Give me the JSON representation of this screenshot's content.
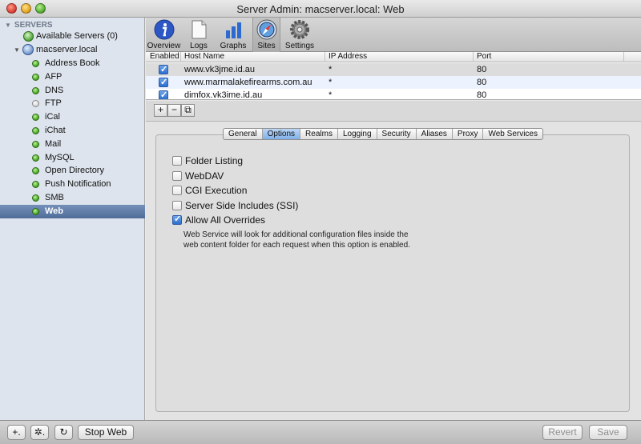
{
  "window": {
    "title": "Server Admin: macserver.local: Web"
  },
  "sidebar": {
    "section_label": "SERVERS",
    "available_servers": "Available Servers (0)",
    "server_name": "macserver.local",
    "services": [
      {
        "label": "Address Book",
        "status": "running"
      },
      {
        "label": "AFP",
        "status": "running"
      },
      {
        "label": "DNS",
        "status": "running"
      },
      {
        "label": "FTP",
        "status": "stopped"
      },
      {
        "label": "iCal",
        "status": "running"
      },
      {
        "label": "iChat",
        "status": "running"
      },
      {
        "label": "Mail",
        "status": "running"
      },
      {
        "label": "MySQL",
        "status": "running"
      },
      {
        "label": "Open Directory",
        "status": "running"
      },
      {
        "label": "Push Notification",
        "status": "running"
      },
      {
        "label": "SMB",
        "status": "running"
      },
      {
        "label": "Web",
        "status": "running",
        "selected": true
      }
    ]
  },
  "toolbar": {
    "items": [
      {
        "label": "Overview",
        "icon": "info-icon"
      },
      {
        "label": "Logs",
        "icon": "document-icon"
      },
      {
        "label": "Graphs",
        "icon": "bar-chart-icon"
      },
      {
        "label": "Sites",
        "icon": "compass-icon",
        "active": true
      },
      {
        "label": "Settings",
        "icon": "gear-icon"
      }
    ]
  },
  "sites_table": {
    "headers": {
      "enabled": "Enabled",
      "host": "Host Name",
      "ip": "IP Address",
      "port": "Port"
    },
    "rows": [
      {
        "enabled": true,
        "host": "www.vk3jme.id.au",
        "ip": "*",
        "port": "80"
      },
      {
        "enabled": true,
        "host": "www.marmalakefirearms.com.au",
        "ip": "*",
        "port": "80"
      },
      {
        "enabled": true,
        "host": "dimfox.vk3ime.id.au",
        "ip": "*",
        "port": "80"
      }
    ]
  },
  "addbar": {
    "add": "+",
    "remove": "−",
    "edit": "⧉"
  },
  "tabs": {
    "general": "General",
    "options": "Options",
    "realms": "Realms",
    "logging": "Logging",
    "security": "Security",
    "aliases": "Aliases",
    "proxy": "Proxy",
    "web_services": "Web Services",
    "active": "Options"
  },
  "options": [
    {
      "label": "Folder Listing",
      "checked": false
    },
    {
      "label": "WebDAV",
      "checked": false
    },
    {
      "label": "CGI Execution",
      "checked": false
    },
    {
      "label": "Server Side Includes (SSI)",
      "checked": false
    },
    {
      "label": "Allow All Overrides",
      "checked": true
    }
  ],
  "note": "Web Service will look for additional configuration files inside the web content folder for each request when this option is enabled.",
  "bottombar": {
    "add": "+.",
    "action": "✲.",
    "refresh": "↻",
    "stop": "Stop Web",
    "revert": "Revert",
    "save": "Save"
  }
}
